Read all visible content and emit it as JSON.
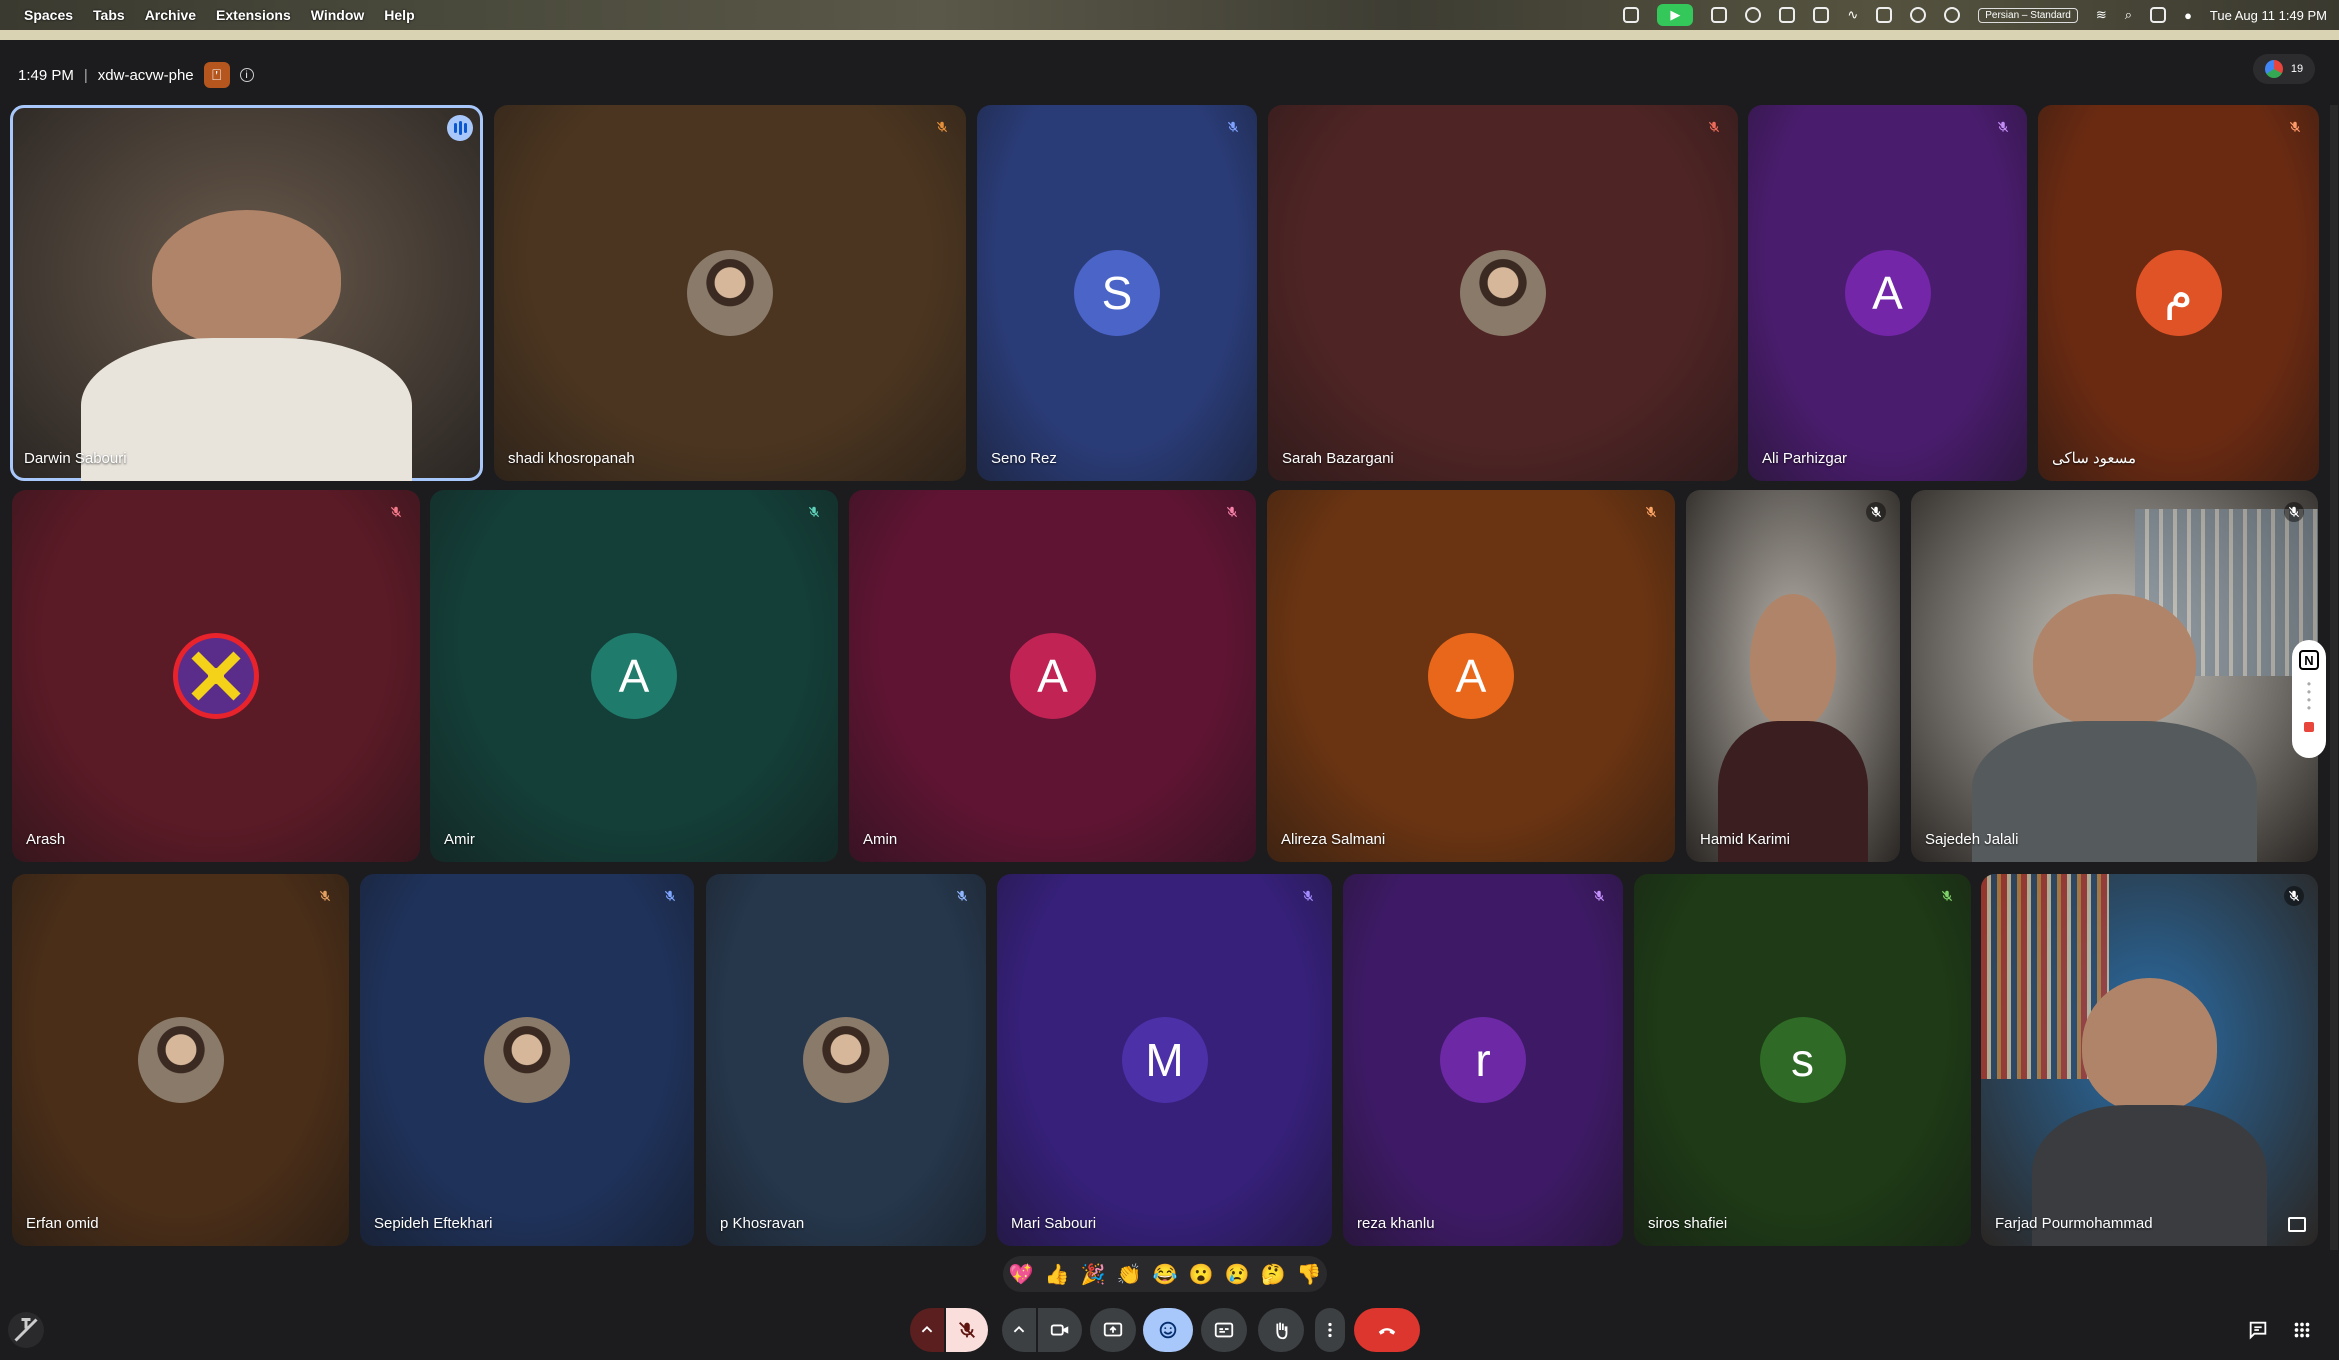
{
  "menubar": {
    "items": [
      "Spaces",
      "Tabs",
      "Archive",
      "Extensions",
      "Window",
      "Help"
    ],
    "keyboard": "Persian – Standard",
    "clock": "Tue Aug 11  1:49 PM"
  },
  "meeting": {
    "time": "1:49 PM",
    "code": "xdw-acvw-phe",
    "participant_count": "19"
  },
  "tiles": [
    {
      "name": "Darwin Sabouri",
      "type": "video",
      "bg": "#6a5a4c",
      "speaking": true
    },
    {
      "name": "shadi khosropanah",
      "type": "photo",
      "bg": "#4b3520",
      "mute_color": "#e58f3a"
    },
    {
      "name": "Seno Rez",
      "type": "letter",
      "letter": "S",
      "bg": "#2a3c78",
      "av": "#4b64c8",
      "mute_color": "#7fa1ff"
    },
    {
      "name": "Sarah Bazargani",
      "type": "photo",
      "bg": "#4e2424",
      "mute_color": "#ef6b5a"
    },
    {
      "name": "Ali Parhizgar",
      "type": "letter",
      "letter": "A",
      "bg": "#4a1c6e",
      "av": "#7326a8",
      "mute_color": "#c48cf5"
    },
    {
      "name": "مسعود ساکی",
      "type": "letter",
      "letter": "م",
      "bg": "#6a2a12",
      "av": "#e05326",
      "mute_color": "#ff9a6a"
    },
    {
      "name": "Arash",
      "type": "logo",
      "bg": "#5a1a26",
      "mute_color": "#f47a8a"
    },
    {
      "name": "Amir",
      "type": "letter",
      "letter": "A",
      "bg": "#143e38",
      "av": "#1f7b6b",
      "mute_color": "#5fd1b8"
    },
    {
      "name": "Amin",
      "type": "letter",
      "letter": "A",
      "bg": "#5e1432",
      "av": "#c02354",
      "mute_color": "#f580a8"
    },
    {
      "name": "Alireza Salmani",
      "type": "letter",
      "letter": "A",
      "bg": "#6a3412",
      "av": "#e8671b",
      "mute_color": "#ffa566"
    },
    {
      "name": "Hamid Karimi",
      "type": "video",
      "bg": "#b8b3ab"
    },
    {
      "name": "Sajedeh Jalali",
      "type": "video",
      "bg": "#cfccc5"
    },
    {
      "name": "Erfan omid",
      "type": "photo",
      "bg": "#4a2e18",
      "mute_color": "#e5a060"
    },
    {
      "name": "Sepideh Eftekhari",
      "type": "photo",
      "bg": "#1f325a",
      "mute_color": "#7fa6ff"
    },
    {
      "name": "p Khosravan",
      "type": "photo",
      "bg": "#26374c",
      "mute_color": "#8fb6ff"
    },
    {
      "name": "Mari Sabouri",
      "type": "letter",
      "letter": "M",
      "bg": "#36207a",
      "av": "#4c30a8",
      "mute_color": "#a58cff"
    },
    {
      "name": "reza khanlu",
      "type": "letter",
      "letter": "r",
      "bg": "#3e1a66",
      "av": "#6d28a6",
      "mute_color": "#c590ff"
    },
    {
      "name": "siros shafiei",
      "type": "letter",
      "letter": "s",
      "bg": "#1e3a16",
      "av": "#2f6a26",
      "mute_color": "#7fd36a"
    },
    {
      "name": "Farjad Pourmohammad",
      "type": "video",
      "bg": "#2a6ea8"
    }
  ],
  "reactions": [
    "💖",
    "👍",
    "🎉",
    "👏",
    "😂",
    "😮",
    "😢",
    "🤔",
    "👎"
  ],
  "notion": {
    "label": "N"
  }
}
